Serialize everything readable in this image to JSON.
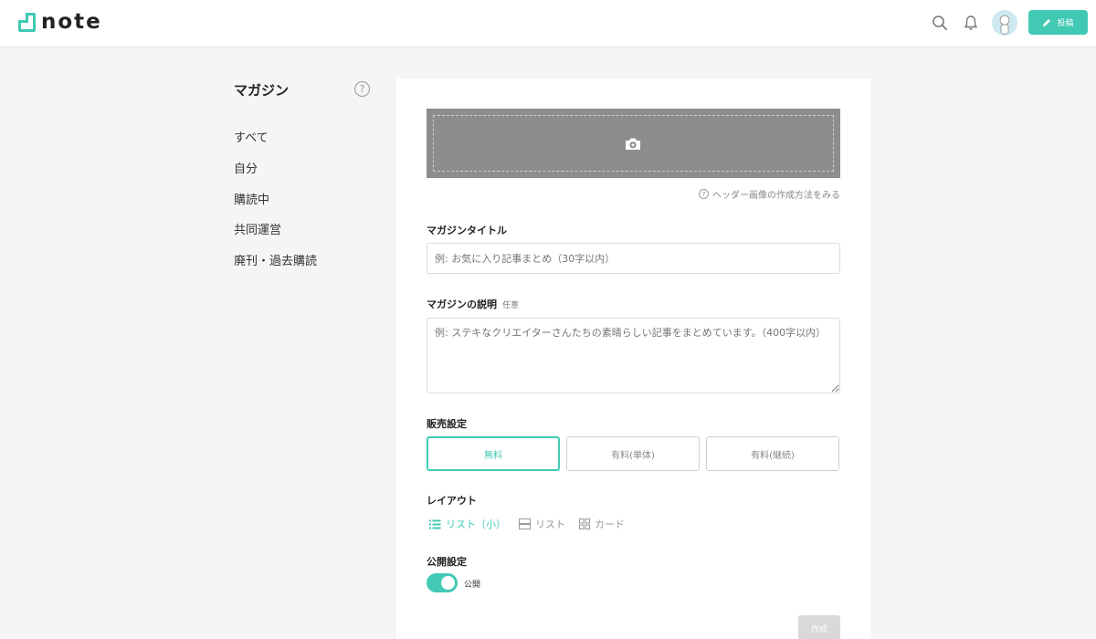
{
  "header": {
    "logo_text": "note",
    "icons": [
      "search-icon",
      "bell-icon"
    ],
    "post_button_label": "投稿"
  },
  "sidebar": {
    "title": "マガジン",
    "items": [
      {
        "label": "すべて"
      },
      {
        "label": "自分"
      },
      {
        "label": "購読中"
      },
      {
        "label": "共同運営"
      },
      {
        "label": "廃刊・過去購読"
      }
    ]
  },
  "form": {
    "header_image_help": "ヘッダー画像の作成方法をみる",
    "title_label": "マガジンタイトル",
    "title_placeholder": "例: お気に入り記事まとめ（30字以内）",
    "description_label": "マガジンの説明",
    "description_optional": "任意",
    "description_placeholder": "例: ステキなクリエイターさんたちの素晴らしい記事をまとめています。（400字以内）",
    "sales_label": "販売設定",
    "sales_options": [
      {
        "label": "無料",
        "selected": true
      },
      {
        "label": "有料(単体)",
        "selected": false
      },
      {
        "label": "有料(継続)",
        "selected": false
      }
    ],
    "layout_label": "レイアウト",
    "layout_options": [
      {
        "label": "リスト（小）",
        "icon": "list-small-icon",
        "selected": true
      },
      {
        "label": "リスト",
        "icon": "list-icon",
        "selected": false
      },
      {
        "label": "カード",
        "icon": "card-grid-icon",
        "selected": false
      }
    ],
    "publish_label": "公開設定",
    "publish_toggle_label": "公開",
    "publish_on": true,
    "submit_label": "作成"
  },
  "colors": {
    "accent": "#41c9b4",
    "header_image_bg": "#8d8d8d"
  }
}
